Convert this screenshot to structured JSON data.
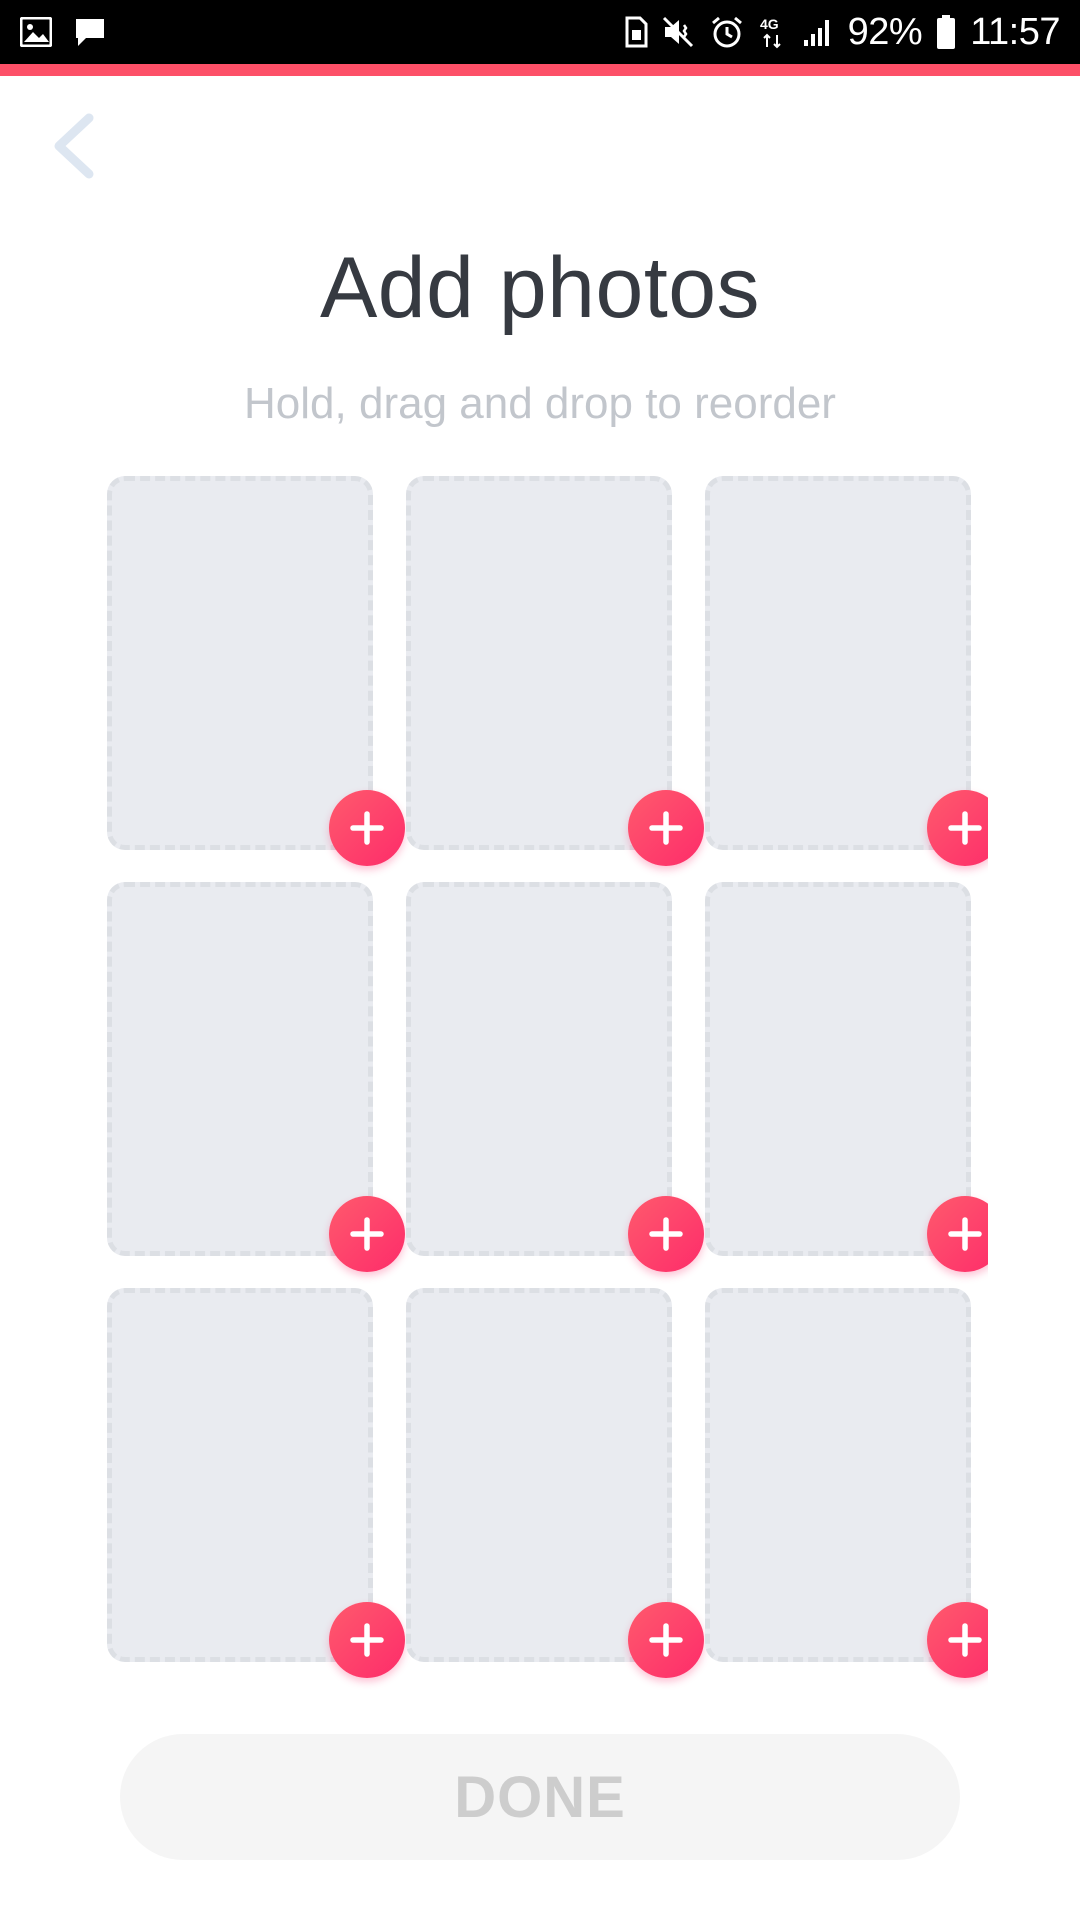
{
  "status_bar": {
    "battery_percent": "92%",
    "time": "11:57",
    "network_type": "4G",
    "left_icons": [
      "gallery-icon",
      "message-icon"
    ],
    "right_icons": [
      "sim-icon",
      "mute-vibrate-icon",
      "alarm-icon",
      "network-4g-icon",
      "signal-icon",
      "battery-icon"
    ]
  },
  "header": {
    "back_icon": "chevron-left-icon",
    "title": "Add photos",
    "subtitle": "Hold, drag and drop to reorder"
  },
  "photo_grid": {
    "columns": 3,
    "rows": 3,
    "slots": [
      {
        "state": "empty",
        "action_icon": "plus-icon"
      },
      {
        "state": "empty",
        "action_icon": "plus-icon"
      },
      {
        "state": "empty",
        "action_icon": "plus-icon"
      },
      {
        "state": "empty",
        "action_icon": "plus-icon"
      },
      {
        "state": "empty",
        "action_icon": "plus-icon"
      },
      {
        "state": "empty",
        "action_icon": "plus-icon"
      },
      {
        "state": "empty",
        "action_icon": "plus-icon"
      },
      {
        "state": "empty",
        "action_icon": "plus-icon"
      },
      {
        "state": "empty",
        "action_icon": "plus-icon"
      }
    ]
  },
  "footer": {
    "done_label": "DONE",
    "done_enabled": false
  },
  "colors": {
    "accent": "#fd5068",
    "add_button_gradient_start": "#ff5a6d",
    "add_button_gradient_end": "#fd2c6a",
    "title_text": "#363a41",
    "subtitle_text": "#c2c6cc",
    "slot_fill": "#e9ebf0",
    "slot_border": "#dcdfe4",
    "done_disabled_bg": "#f5f5f5",
    "done_disabled_text": "#cdcdcd"
  }
}
